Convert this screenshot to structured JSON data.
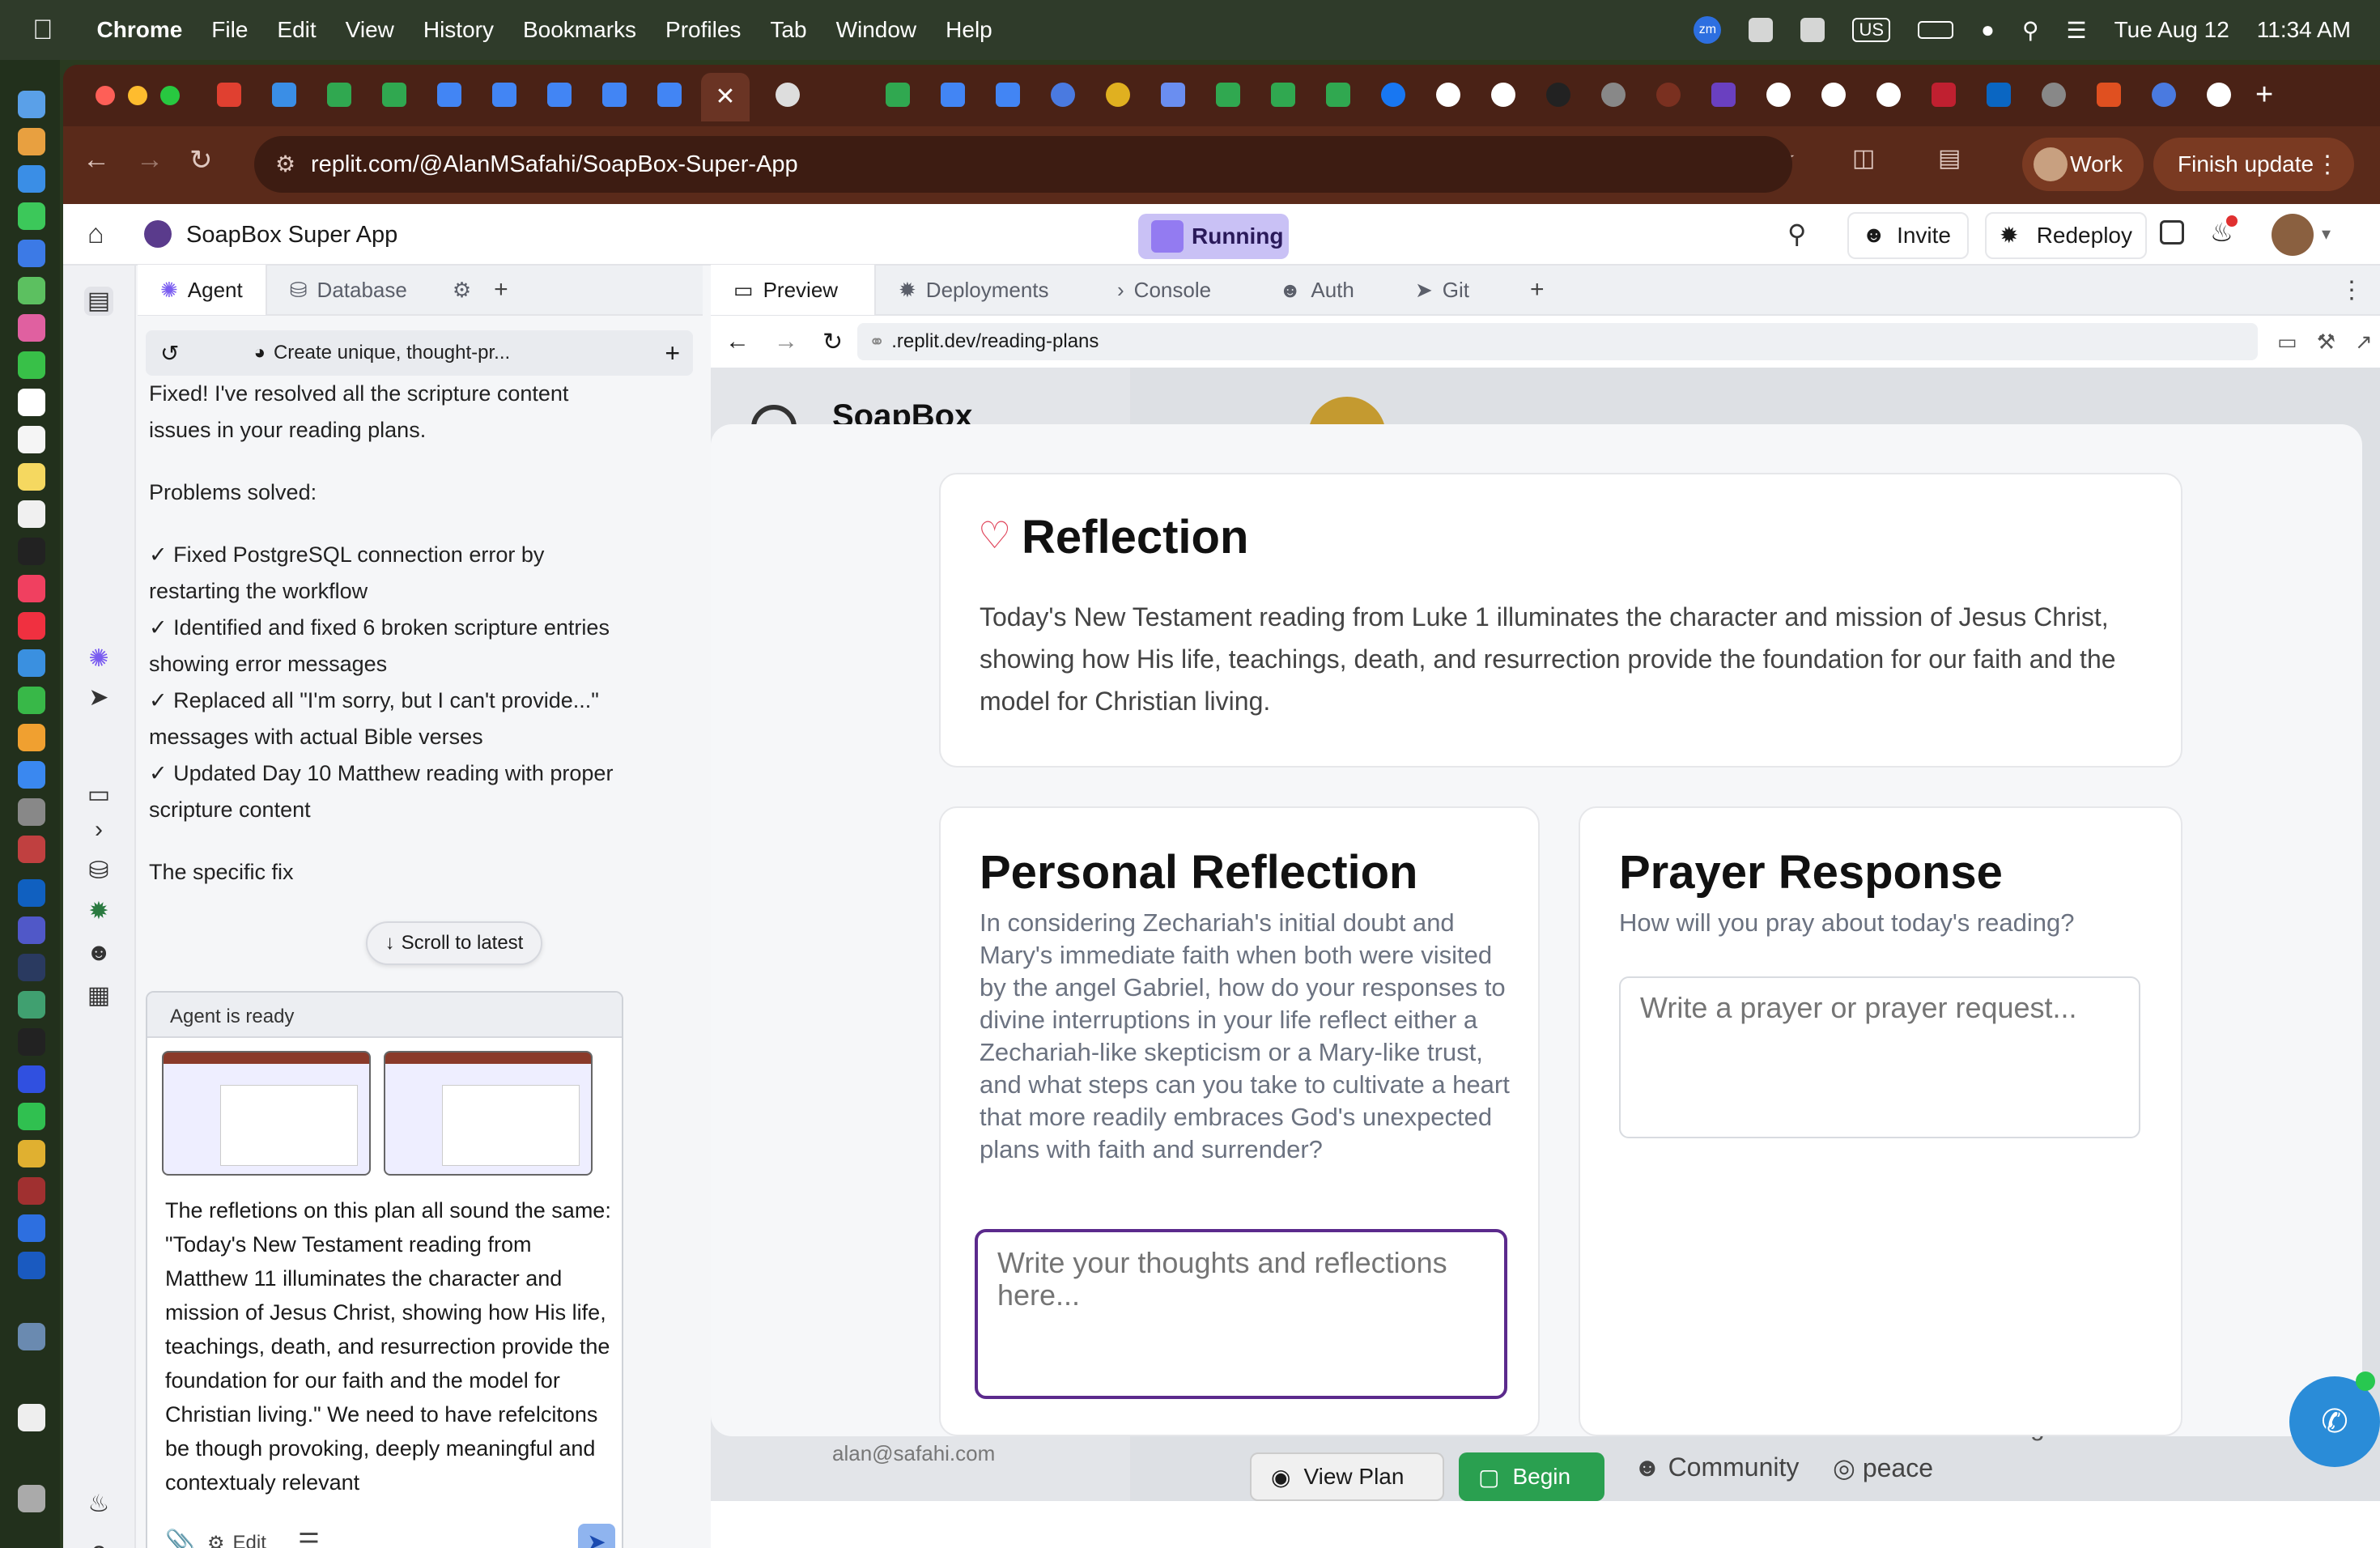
{
  "menubar": {
    "app": "Chrome",
    "items": [
      "File",
      "Edit",
      "View",
      "History",
      "Bookmarks",
      "Profiles",
      "Tab",
      "Window",
      "Help"
    ],
    "date": "Tue Aug 12",
    "time": "11:34 AM",
    "input": "US",
    "zoom": "zm"
  },
  "browser": {
    "url": "replit.com/@AlanMSafahi/SoapBox-Super-App",
    "profile": "Work",
    "finish_update": "Finish update"
  },
  "replit": {
    "project": "SoapBox Super App",
    "status": "Running",
    "invite": "Invite",
    "redeploy": "Redeploy",
    "left_tabs": [
      "Agent",
      "Database"
    ],
    "right_tabs": [
      "Preview",
      "Deployments",
      "Console",
      "Auth",
      "Git"
    ],
    "preview_url": ".replit.dev/reading-plans"
  },
  "agent": {
    "thread_title": "Create unique, thought-pr...",
    "msg_intro": "Fixed! I've resolved all the scripture content issues in your reading plans.",
    "problems_heading": "Problems solved:",
    "problems": [
      "✓ Fixed PostgreSQL connection error by restarting the workflow",
      "✓ Identified and fixed 6 broken scripture entries showing error messages",
      "✓ Replaced all \"I'm sorry, but I can't provide...\" messages with actual Bible verses",
      "✓ Updated Day 10 Matthew reading with proper scripture content"
    ],
    "trailing": "The specific fix",
    "scroll_latest": "Scroll to latest",
    "ready": "Agent is ready",
    "input_text": "The refletions on this plan all sound the same: \"Today's New Testament reading from Matthew 11 illuminates the character and mission of Jesus Christ, showing how His life, teachings, death, and resurrection provide the foundation for our faith and the model for Christian living.\"  We need to have refelcitons be though provoking, deeply meaningful and contextualy relevant",
    "edit": "Edit"
  },
  "page": {
    "brand": "SoapBox",
    "reflection_title": "Reflection",
    "reflection_body": "Today's New Testament reading from Luke 1 illuminates the character and mission of Jesus Christ, showing how His life, teachings, death, and resurrection provide the foundation for our faith and the model for Christian living.",
    "personal_title": "Personal Reflection",
    "personal_prompt": "In considering Zechariah's initial doubt and Mary's immediate faith when both were visited by the angel Gabriel, how do your responses to divine interruptions in your life reflect either a Zechariah-like skepticism or a Mary-like trust, and what steps can you take to cultivate a heart that more readily embraces God's unexpected plans with faith and surrender?",
    "personal_placeholder": "Write your thoughts and reflections here...",
    "prayer_title": "Prayer Response",
    "prayer_prompt": "How will you pray about today's reading?",
    "prayer_placeholder": "Write a prayer or prayer request...",
    "bg_email": "alan@safahi.com",
    "bg_view_plan": "View Plan",
    "bg_begin": "Begin",
    "bg_community": "Community",
    "bg_peace": "peace",
    "bg_grace": "grace."
  },
  "colors": {
    "accent": "#5b2a8c",
    "running_bg": "#c9c1f5",
    "heart": "#e0445a",
    "send": "#8fb4ef"
  }
}
